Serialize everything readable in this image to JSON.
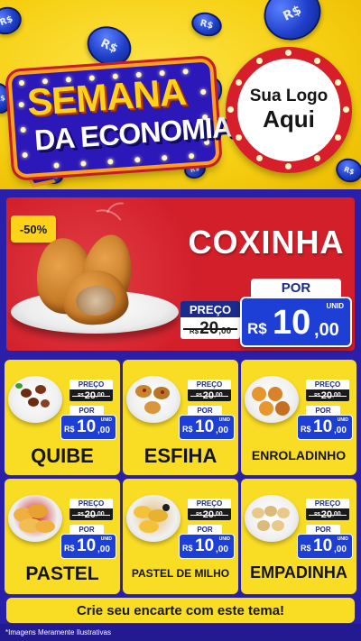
{
  "colors": {
    "yellow": "#f9dc24",
    "red": "#d21f2a",
    "blue": "#1d3fd6",
    "navy": "#2a1fa8",
    "white": "#ffffff",
    "coin_symbol": "R$"
  },
  "header": {
    "title_line1": "SEMANA",
    "title_line2": "DA ECONOMIA",
    "logo_line1": "Sua Logo",
    "logo_line2": "Aqui"
  },
  "hero": {
    "discount": "-50%",
    "name": "COXINHA",
    "old_label": "PREÇO",
    "old_currency": "R$",
    "old_value": "20",
    "old_cents": ",00",
    "new_label": "POR",
    "unit": "UNID",
    "currency": "R$",
    "value": "10",
    "cents": ",00"
  },
  "price_labels": {
    "old": "PREÇO",
    "new": "POR",
    "unit": "UNID",
    "currency": "R$"
  },
  "products": [
    {
      "name": "QUIBE",
      "old_value": "20",
      "old_cents": ",00",
      "value": "10",
      "cents": ",00",
      "icon": "kibbeh-plate-icon"
    },
    {
      "name": "ESFIHA",
      "old_value": "20",
      "old_cents": ",00",
      "value": "10",
      "cents": ",00",
      "icon": "esfiha-plate-icon"
    },
    {
      "name": "ENROLADINHO",
      "old_value": "20",
      "old_cents": ",00",
      "value": "10",
      "cents": ",00",
      "icon": "enroladinho-plate-icon"
    },
    {
      "name": "PASTEL",
      "old_value": "20",
      "old_cents": ",00",
      "value": "10",
      "cents": ",00",
      "icon": "pastel-basket-icon"
    },
    {
      "name": "PASTEL DE MILHO",
      "old_value": "20",
      "old_cents": ",00",
      "value": "10",
      "cents": ",00",
      "icon": "corn-pastel-basket-icon"
    },
    {
      "name": "EMPADINHA",
      "old_value": "20",
      "old_cents": ",00",
      "value": "10",
      "cents": ",00",
      "icon": "empadinha-plate-icon"
    }
  ],
  "footer": {
    "cta": "Crie seu encarte com este tema!",
    "disclaimer": "*Imagens Meramente Ilustrativas"
  }
}
